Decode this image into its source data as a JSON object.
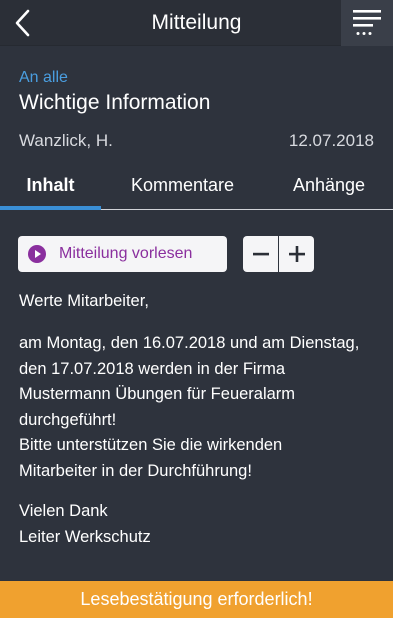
{
  "header": {
    "title": "Mitteilung",
    "back_icon": "chevron-left-icon",
    "menu_icon": "menu-icon"
  },
  "message": {
    "recipient": "An alle",
    "subject": "Wichtige Information",
    "author": "Wanzlick, H.",
    "date": "12.07.2018"
  },
  "tabs": [
    {
      "label": "Inhalt",
      "active": true
    },
    {
      "label": "Kommentare",
      "active": false
    },
    {
      "label": "Anhänge",
      "active": false
    }
  ],
  "actions": {
    "read_aloud_label": "Mitteilung vorlesen",
    "zoom_out_label": "−",
    "zoom_in_label": "+"
  },
  "content": {
    "greeting": "Werte Mitarbeiter,",
    "paragraph_lines": [
      "am Montag, den 16.07.2018 und am Dienstag,",
      "den 17.07.2018 werden in der Firma",
      "Mustermann Übungen für Feueralarm",
      "durchgeführt!",
      "Bitte unterstützen Sie die wirkenden",
      "Mitarbeiter in der Durchführung!"
    ],
    "closing_lines": [
      "Vielen Dank",
      "Leiter Werkschutz"
    ]
  },
  "footer": {
    "label": "Lesebestätigung erforderlich!"
  },
  "colors": {
    "background": "#2e333d",
    "accent_blue": "#3a8fd6",
    "recipient_blue": "#4a9ee0",
    "purple": "#8a2f9e",
    "footer_orange": "#f0a12f"
  }
}
